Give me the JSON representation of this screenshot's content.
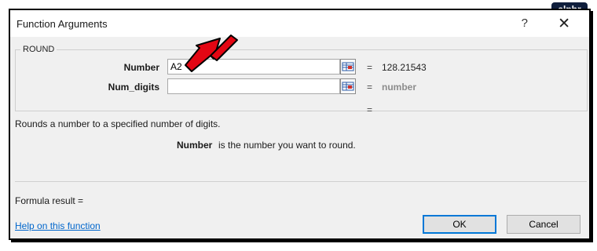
{
  "dialog": {
    "title": "Function Arguments",
    "help_glyph": "?",
    "close_glyph": "✕"
  },
  "watermark": "alphr",
  "function": {
    "name": "ROUND",
    "args": [
      {
        "label": "Number",
        "value": "A2",
        "result": "128.21543"
      },
      {
        "label": "Num_digits",
        "value": "",
        "result": "number"
      }
    ],
    "overall_eq": "="
  },
  "description": {
    "summary": "Rounds a number to a specified number of digits.",
    "arg_name": "Number",
    "arg_desc": "is the number you want to round."
  },
  "formula_result_label": "Formula result =",
  "help_link": "Help on this function",
  "buttons": {
    "ok": "OK",
    "cancel": "Cancel"
  },
  "colors": {
    "accent": "#0078d7",
    "arrow": "#e30613"
  }
}
